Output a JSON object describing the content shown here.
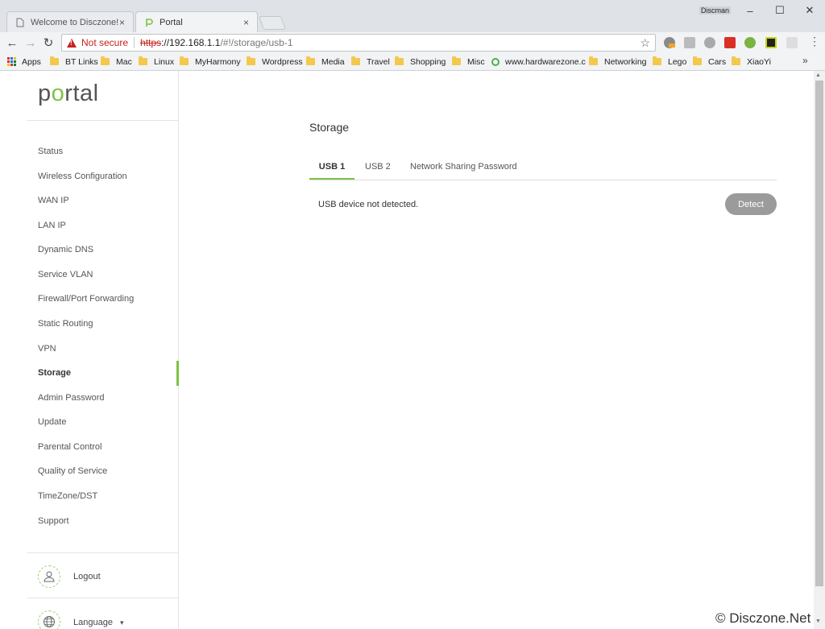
{
  "browser": {
    "tabs": [
      {
        "title": "Welcome to Disczone! -",
        "close": "×"
      },
      {
        "title": "Portal",
        "close": "×"
      }
    ],
    "profile": "Discman",
    "window": {
      "minimize": "–",
      "maximize": "☐",
      "close": "✕"
    },
    "nav": {
      "back": "←",
      "forward": "→",
      "reload": "↻"
    },
    "address": {
      "security_text": "Not secure",
      "scheme": "https",
      "host": "://192.168.1.1",
      "path": "/#!/storage/usb-1"
    },
    "bookmark_star": "☆",
    "menu": "⋮",
    "bookmarks": [
      {
        "label": "Apps",
        "icon": "apps-grid-icon"
      },
      {
        "label": "BT Links",
        "icon": "folder-icon"
      },
      {
        "label": "Mac",
        "icon": "folder-icon"
      },
      {
        "label": "Linux",
        "icon": "folder-icon"
      },
      {
        "label": "MyHarmony",
        "icon": "folder-icon"
      },
      {
        "label": "Wordpress",
        "icon": "folder-icon"
      },
      {
        "label": "Media",
        "icon": "folder-icon"
      },
      {
        "label": "Travel",
        "icon": "folder-icon"
      },
      {
        "label": "Shopping",
        "icon": "folder-icon"
      },
      {
        "label": "Misc",
        "icon": "folder-icon"
      },
      {
        "label": "www.hardwarezone.c",
        "icon": "site-icon"
      },
      {
        "label": "Networking",
        "icon": "folder-icon"
      },
      {
        "label": "Lego",
        "icon": "folder-icon"
      },
      {
        "label": "Cars",
        "icon": "folder-icon"
      },
      {
        "label": "XiaoYi",
        "icon": "folder-icon"
      }
    ],
    "bookmarks_more": "»"
  },
  "sidebar": {
    "logo_pre": "p",
    "logo_o": "o",
    "logo_post": "rtal",
    "items": [
      {
        "label": "Status"
      },
      {
        "label": "Wireless Configuration"
      },
      {
        "label": "WAN IP"
      },
      {
        "label": "LAN IP"
      },
      {
        "label": "Dynamic DNS"
      },
      {
        "label": "Service VLAN"
      },
      {
        "label": "Firewall/Port Forwarding"
      },
      {
        "label": "Static Routing"
      },
      {
        "label": "VPN"
      },
      {
        "label": "Storage"
      },
      {
        "label": "Admin Password"
      },
      {
        "label": "Update"
      },
      {
        "label": "Parental Control"
      },
      {
        "label": "Quality of Service"
      },
      {
        "label": "TimeZone/DST"
      },
      {
        "label": "Support"
      }
    ],
    "active_item": "Storage",
    "logout_label": "Logout",
    "language_label": "Language",
    "language_caret": "▾"
  },
  "main": {
    "title": "Storage",
    "tabs": [
      {
        "label": "USB 1"
      },
      {
        "label": "USB 2"
      },
      {
        "label": "Network Sharing Password"
      }
    ],
    "active_tab": "USB 1",
    "message": "USB device not detected.",
    "detect_label": "Detect"
  },
  "watermark": "© Disczone.Net",
  "colors": {
    "accent": "#7cc242",
    "warning": "#c5221f",
    "detect_button": "#9b9b9b"
  }
}
